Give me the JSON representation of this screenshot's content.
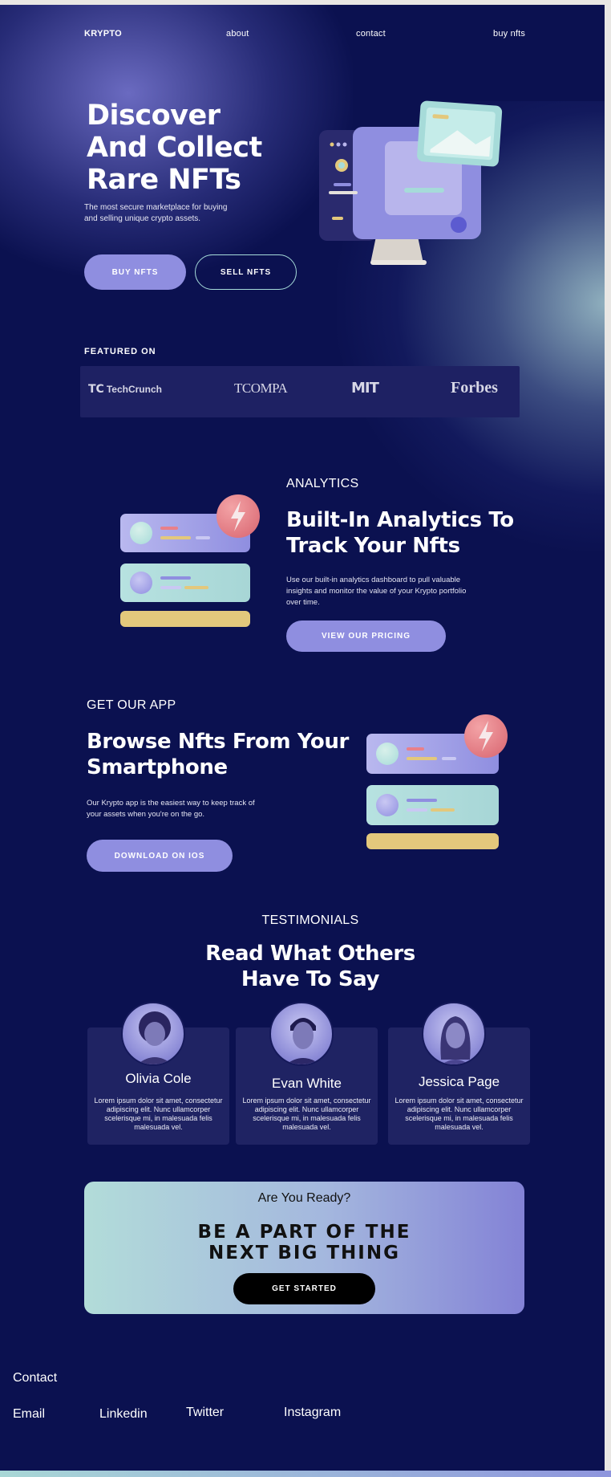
{
  "nav": {
    "logo": "KRYPTO",
    "links": [
      "about",
      "contact",
      "buy nfts"
    ]
  },
  "hero": {
    "title_lines": [
      "Discover",
      "And Collect",
      "Rare NFTs"
    ],
    "subtitle_lines": [
      "The most secure marketplace for buying",
      "and selling unique crypto assets."
    ],
    "buy_label": "BUY NFTS",
    "sell_label": "SELL NFTS"
  },
  "featured": {
    "label": "FEATURED ON",
    "brands": [
      "TechCrunch",
      "TCOMPA",
      "MIT",
      "Forbes"
    ]
  },
  "analytics": {
    "eyebrow": "ANALYTICS",
    "title_lines": [
      "Built-In Analytics To",
      "Track Your Nfts"
    ],
    "body_lines": [
      "Use our built-in analytics dashboard to pull valuable",
      "insights and monitor the value of your Krypto portfolio",
      "over time."
    ],
    "button": "VIEW OUR PRICING"
  },
  "app": {
    "eyebrow": "GET OUR APP",
    "title_lines": [
      "Browse Nfts From Your",
      "Smartphone"
    ],
    "body_lines": [
      "Our Krypto app is the easiest way to keep track of",
      "your assets when you're on the go."
    ],
    "button": "DOWNLOAD ON IOS"
  },
  "testimonials": {
    "eyebrow": "TESTIMONIALS",
    "title_lines": [
      "Read What Others",
      "Have To Say"
    ],
    "items": [
      {
        "name": "Olivia Cole",
        "text_lines": [
          "Lorem ipsum dolor sit amet, consectetur",
          "adipiscing elit. Nunc ullamcorper",
          "scelerisque mi, in malesuada felis",
          "malesuada vel."
        ]
      },
      {
        "name": "Evan White",
        "text_lines": [
          "Lorem ipsum dolor sit amet, consectetur",
          "adipiscing elit. Nunc ullamcorper",
          "scelerisque mi, in malesuada felis",
          "malesuada vel."
        ]
      },
      {
        "name": "Jessica Page",
        "text_lines": [
          "Lorem ipsum dolor sit amet, consectetur",
          "adipiscing elit. Nunc ullamcorper",
          "scelerisque mi, in malesuada felis",
          "malesuada vel."
        ]
      }
    ]
  },
  "cta": {
    "kicker": "Are You Ready?",
    "title_lines": [
      "BE A PART OF THE",
      "NEXT BIG THING"
    ],
    "button": "GET STARTED"
  },
  "footer": {
    "heading": "Contact",
    "links": [
      "Email",
      "Linkedin",
      "Twitter",
      "Instagram"
    ]
  },
  "colors": {
    "background": "#0b1150",
    "accent": "#8f8ee0",
    "mint": "#a6dbd9",
    "card": "#1f2363"
  },
  "icons": [
    "monitor-illustration",
    "lightning-icon",
    "globe-icon",
    "mountain-image-icon"
  ]
}
